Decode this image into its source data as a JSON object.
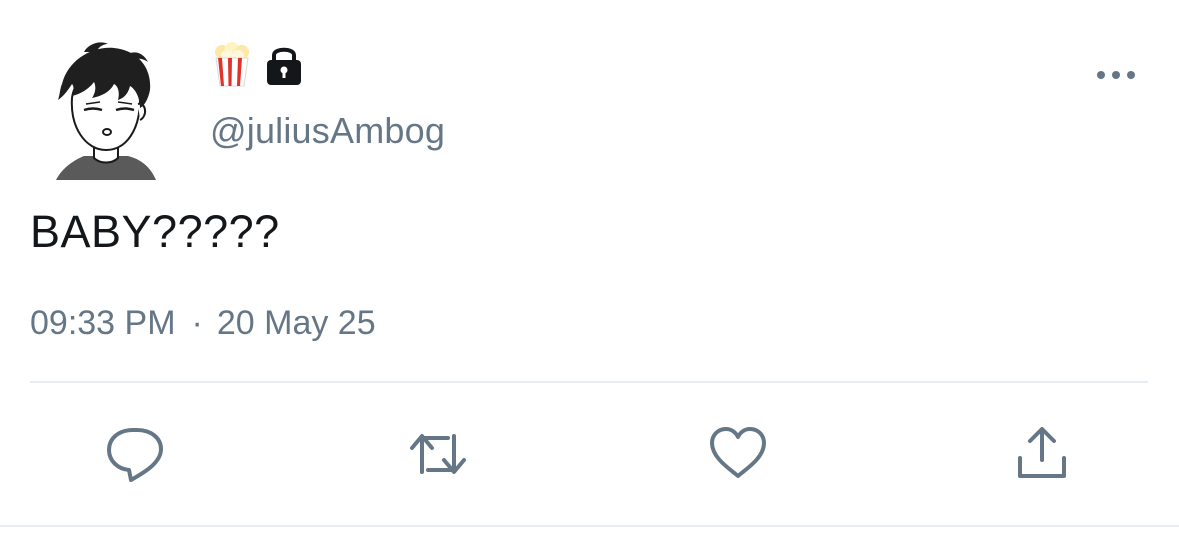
{
  "tweet": {
    "name_emoji": "🍿",
    "handle": "@juliusAmbog",
    "text": "BABY?????",
    "time": "09:33 PM",
    "separator": "·",
    "date": "20 May 25"
  },
  "icons": {
    "avatar": "avatar-illustration",
    "name": "popcorn-icon",
    "protected": "lock-icon",
    "more": "more-horizontal-icon",
    "reply": "reply-icon",
    "retweet": "retweet-icon",
    "like": "heart-icon",
    "share": "share-icon"
  },
  "colors": {
    "text_primary": "#14171a",
    "text_secondary": "#657786",
    "icon_gray": "#657786",
    "divider": "#e6ecf0"
  }
}
